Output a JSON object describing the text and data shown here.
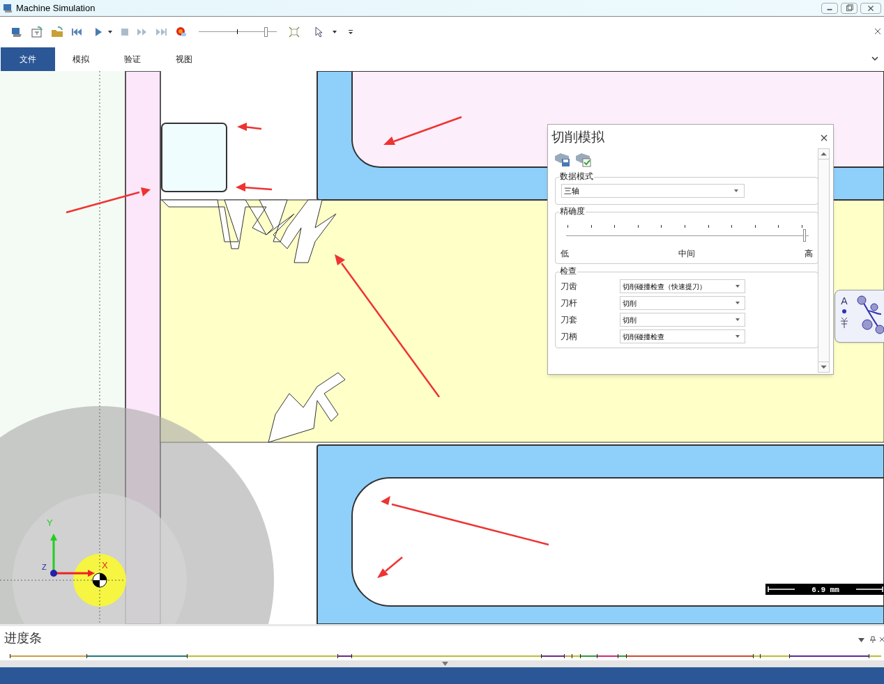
{
  "window": {
    "title": "Machine Simulation"
  },
  "toolbar": {
    "slider": {
      "level": 0.88
    }
  },
  "ribbon_tabs": [
    {
      "label": "文件",
      "selected": true
    },
    {
      "label": "模拟",
      "selected": false
    },
    {
      "label": "验证",
      "selected": false
    },
    {
      "label": "视图",
      "selected": false
    }
  ],
  "viewport": {
    "axis_labels": [
      "Y",
      "Z",
      "X"
    ],
    "scale_bar": "6.9 mm"
  },
  "dialog": {
    "title": "切削模拟",
    "data_mode": {
      "label": "数据模式",
      "value": "三轴"
    },
    "precision": {
      "label": "精确度",
      "level": 1.0,
      "labels": [
        "低",
        "中间",
        "高"
      ]
    },
    "check": {
      "label": "检查",
      "rows": [
        {
          "label": "刀齿",
          "value": "切削碰撞检查（快速提刀）"
        },
        {
          "label": "刀杆",
          "value": "切削"
        },
        {
          "label": "刀套",
          "value": "切削"
        },
        {
          "label": "刀柄",
          "value": "切削碰撞检查"
        }
      ]
    }
  },
  "language_bar": {
    "label": "A"
  },
  "progress_panel": {
    "title": "进度条"
  }
}
